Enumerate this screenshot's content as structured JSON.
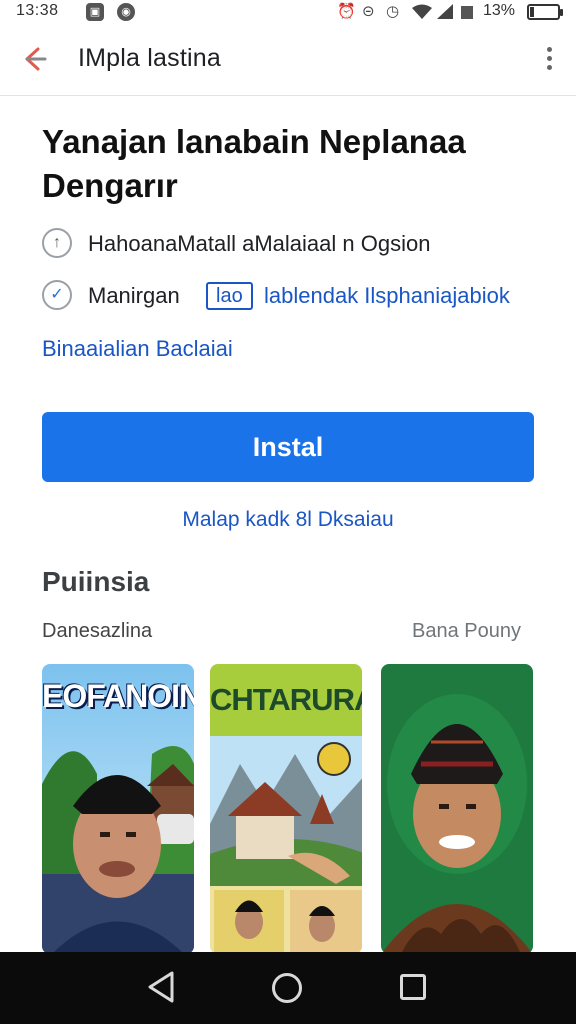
{
  "status_bar": {
    "time": "13:38",
    "battery_percent": "13%",
    "battery_level": 0.13,
    "icons": [
      "alarm-icon",
      "do-not-disturb-icon",
      "clock-icon",
      "wifi-icon",
      "signal-icon",
      "signal-icon-2",
      "battery-icon"
    ]
  },
  "app_bar": {
    "title": "IMpla lastina",
    "back_icon": "arrow-left-icon",
    "more_icon": "more-vertical-icon"
  },
  "page": {
    "title": "Yanajan lanabain Neplanaa Dengarır",
    "info_rows": [
      {
        "icon": "info-icon",
        "text": "HahoanaMatall aMalaiaal n Ogsion"
      },
      {
        "icon": "check-circle-icon",
        "label": "Manirgan",
        "chip": "lao",
        "link": "lablendak Ilsphaniajabiok"
      }
    ],
    "details_link": "Binaaialian Baclaiai",
    "install_button": "Instal",
    "secondary_link": "Malap kadk 8l Dksaiau"
  },
  "screenshots_section": {
    "title": "Puiinsia",
    "left_label": "Danesazlina",
    "right_label": "Bana Pouny",
    "screenshots": [
      {
        "caption": "EOFANOIN"
      },
      {
        "caption": "CHTARURA"
      },
      {
        "caption": ""
      }
    ]
  },
  "colors": {
    "accent": "#1a73e8",
    "link": "#1a56c4",
    "nav_bar": "#0b0b0b"
  },
  "nav_bar": {
    "icons": [
      "nav-back-icon",
      "nav-home-icon",
      "nav-recents-icon"
    ]
  }
}
